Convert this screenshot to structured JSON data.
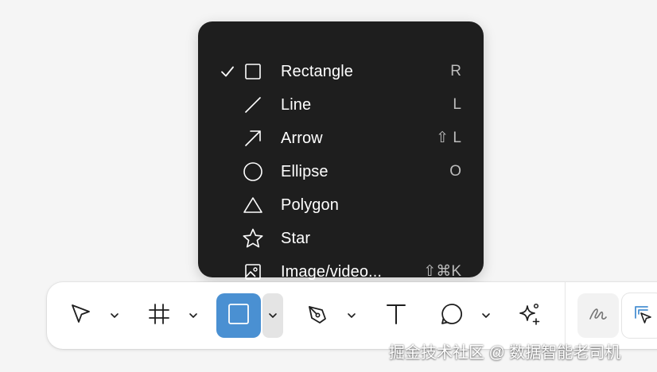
{
  "menu": {
    "items": [
      {
        "label": "Rectangle",
        "shortcut": "R",
        "icon": "square-icon",
        "checked": true
      },
      {
        "label": "Line",
        "shortcut": "L",
        "icon": "line-icon",
        "checked": false
      },
      {
        "label": "Arrow",
        "shortcut": "⇧ L",
        "icon": "arrow-icon",
        "checked": false
      },
      {
        "label": "Ellipse",
        "shortcut": "O",
        "icon": "ellipse-icon",
        "checked": false
      },
      {
        "label": "Polygon",
        "shortcut": "",
        "icon": "triangle-icon",
        "checked": false
      },
      {
        "label": "Star",
        "shortcut": "",
        "icon": "star-icon",
        "checked": false
      },
      {
        "label": "Image/video...",
        "shortcut": "⇧⌘K",
        "icon": "image-icon",
        "checked": false
      }
    ]
  },
  "toolbar": {
    "tools": [
      {
        "name": "move",
        "icon": "pointer-icon"
      },
      {
        "name": "frame",
        "icon": "frame-icon"
      },
      {
        "name": "shape",
        "icon": "square-icon",
        "active": true
      },
      {
        "name": "pen",
        "icon": "pen-icon"
      },
      {
        "name": "text",
        "icon": "text-icon"
      },
      {
        "name": "comment",
        "icon": "comment-icon"
      },
      {
        "name": "actions",
        "icon": "sparkle-icon"
      }
    ],
    "right": [
      {
        "name": "draw",
        "icon": "squiggle-icon"
      },
      {
        "name": "dev-mode",
        "icon": "dev-mode-icon"
      }
    ]
  },
  "watermark": "掘金技术社区 @ 数据智能老司机",
  "colors": {
    "menu_bg": "#1e1e1e",
    "active_tool": "#4a90d2",
    "canvas": "#f5f5f5"
  }
}
